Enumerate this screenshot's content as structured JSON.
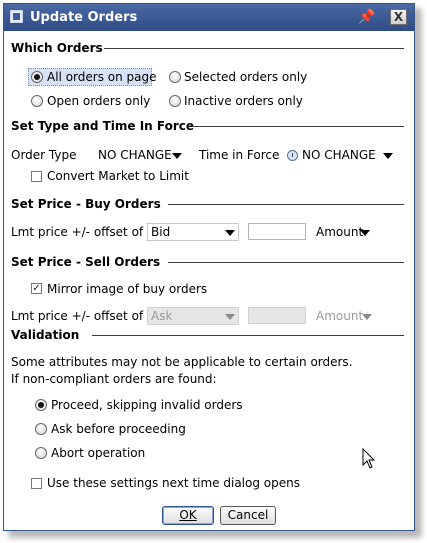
{
  "window": {
    "title": "Update Orders",
    "icons": {
      "app": "app-window-icon",
      "pin": "pin-icon",
      "close": "close-icon"
    },
    "close_label": "X"
  },
  "which_orders": {
    "heading": "Which Orders",
    "options": [
      {
        "label": "All orders on page",
        "selected": true
      },
      {
        "label": "Selected orders only",
        "selected": false
      },
      {
        "label": "Open orders only",
        "selected": false
      },
      {
        "label": "Inactive orders only",
        "selected": false
      }
    ]
  },
  "type_tif": {
    "heading": "Set Type and Time In Force",
    "order_type_label": "Order Type",
    "order_type_value": "NO CHANGE",
    "tif_label": "Time in Force",
    "tif_value": "NO CHANGE",
    "convert_label": "Convert Market to Limit",
    "convert_checked": false
  },
  "buy": {
    "heading": "Set Price - Buy Orders",
    "offset_label": "Lmt price +/- offset of",
    "offset_value": "Bid",
    "amount_value": "",
    "amount_type": "Amount"
  },
  "sell": {
    "heading": "Set Price - Sell Orders",
    "mirror_label": "Mirror image of buy orders",
    "mirror_checked": true,
    "offset_label": "Lmt price +/- offset of",
    "offset_value": "Ask",
    "amount_value": "",
    "amount_type": "Amount"
  },
  "validation": {
    "heading": "Validation",
    "note_line1": "Some attributes may not be applicable to certain orders.",
    "note_line2": "If non-compliant orders are found:",
    "options": [
      {
        "label": "Proceed, skipping invalid orders",
        "selected": true
      },
      {
        "label": "Ask before proceeding",
        "selected": false
      },
      {
        "label": "Abort operation",
        "selected": false
      }
    ]
  },
  "footer": {
    "remember_label": "Use these settings next time dialog opens",
    "remember_checked": false,
    "ok_label": "OK",
    "cancel_label": "Cancel"
  },
  "colors": {
    "titlebar": "#2f4b83",
    "selection": "#d6e2f5"
  }
}
